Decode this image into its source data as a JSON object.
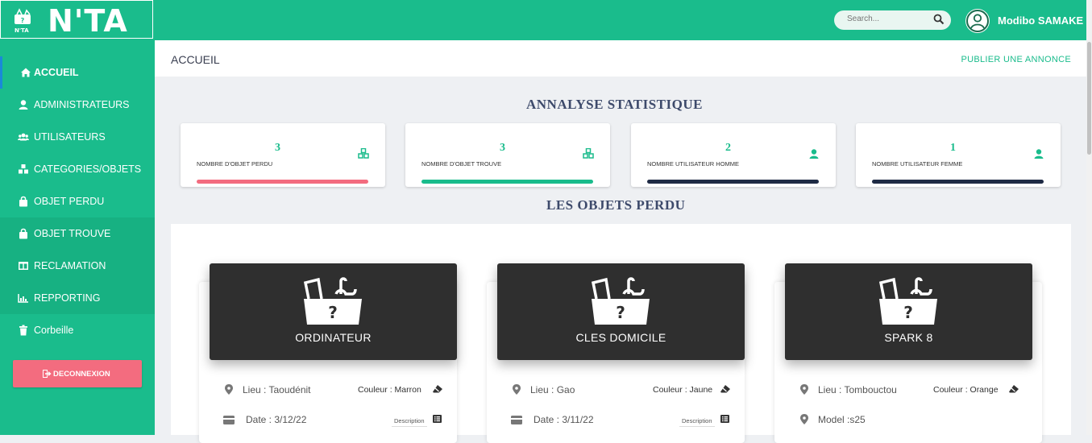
{
  "app": {
    "name": "N'TA",
    "logo_small": "N'TA"
  },
  "topbar": {
    "search_placeholder": "Search...",
    "user_name": "Modibo SAMAKE"
  },
  "sidebar": {
    "items": [
      {
        "label": "ACCUEIL",
        "icon": "home-icon"
      },
      {
        "label": "ADMINISTRATEURS",
        "icon": "user-icon"
      },
      {
        "label": "UTILISATEURS",
        "icon": "users-icon"
      },
      {
        "label": "CATEGORIES/OBJETS",
        "icon": "cubes-icon"
      },
      {
        "label": "OBJET PERDU",
        "icon": "bag-icon"
      },
      {
        "label": "OBJET TROUVE",
        "icon": "bag-icon"
      },
      {
        "label": "RECLAMATION",
        "icon": "columns-icon"
      },
      {
        "label": "REPPORTING",
        "icon": "bar-chart-icon"
      },
      {
        "label": "Corbeille",
        "icon": "trash-icon"
      }
    ],
    "logout_label": "DECONNEXION"
  },
  "header": {
    "title": "ACCUEIL",
    "publish_label": "PUBLIER UNE ANNONCE"
  },
  "stats": {
    "title": "ANNALYSE STATISTIQUE",
    "cards": [
      {
        "value": "3",
        "label": "NOMBRE D'OBJET PERDU",
        "icon": "cubes-icon",
        "bar_color": "#f36c7f"
      },
      {
        "value": "3",
        "label": "NOMBRE D'OBJET TROUVE",
        "icon": "cubes-icon",
        "bar_color": "#1abc8c"
      },
      {
        "value": "2",
        "label": "NOMBRE UTILISATEUR HOMME",
        "icon": "user-icon",
        "bar_color": "#1e2a44"
      },
      {
        "value": "1",
        "label": "NOMBRE UTILISATEUR FEMME",
        "icon": "user-icon",
        "bar_color": "#1e2a44"
      }
    ]
  },
  "lost": {
    "title": "LES OBJETS PERDU",
    "items": [
      {
        "name": "ORDINATEUR",
        "lieu": "Lieu : Taoudénit",
        "couleur": "Couleur : Marron",
        "second": "Date : 3/12/22",
        "desc_label": "Description"
      },
      {
        "name": "CLES DOMICILE",
        "lieu": "Lieu : Gao",
        "couleur": "Couleur : Jaune",
        "second": "Date : 3/11/22",
        "desc_label": "Description"
      },
      {
        "name": "SPARK 8",
        "lieu": "Lieu : Tombouctou",
        "couleur": "Couleur : Orange",
        "second": "Model :s25"
      }
    ]
  },
  "colors": {
    "brand": "#1abc8c",
    "danger": "#f36c7f",
    "navy": "#1e2a44",
    "hero_bg": "#2f2f2f"
  }
}
